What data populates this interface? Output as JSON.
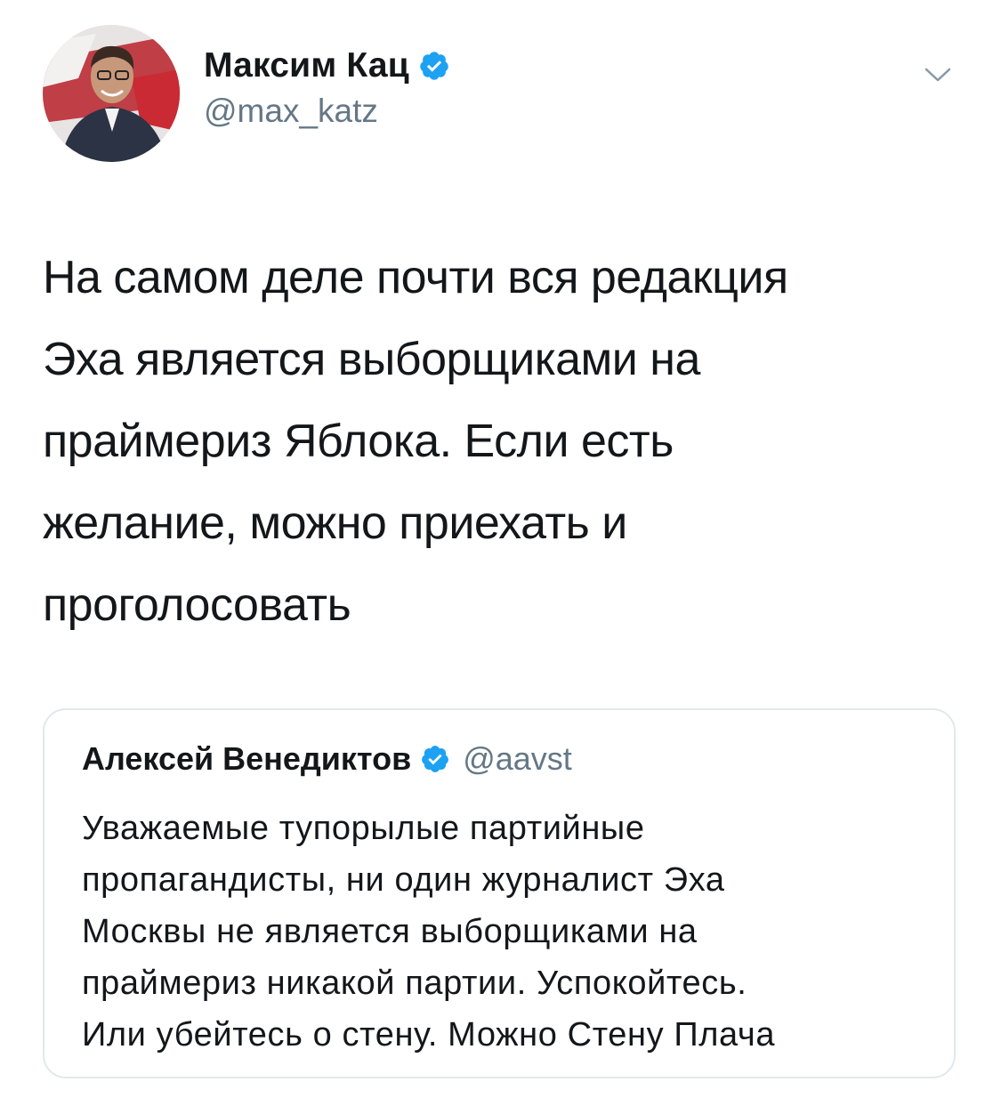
{
  "author": {
    "display_name": "Максим Кац",
    "handle": "@max_katz",
    "verified": true,
    "avatar_icon": "avatar-photo"
  },
  "menu_icon": "chevron-down-icon",
  "tweet": {
    "text": "На самом деле почти вся редакция\nЭха является выборщиками на\nпраймериз Яблока. Если есть\nжелание, можно приехать и\nпроголосовать"
  },
  "quoted_tweet": {
    "display_name": "Алексей Венедиктов",
    "handle": "@aavst",
    "verified": true,
    "text": "Уважаемые тупорылые партийные\nпропагандисты, ни один журналист Эха\nМосквы не является  выборщиками на\nпраймериз никакой партии. Успокойтесь.\nИли убейтесь о стену. Можно Стену Плача"
  },
  "colors": {
    "verified_blue": "#1da1f2",
    "text_primary": "#14171a",
    "text_secondary": "#657786",
    "border": "#e1e8ed"
  }
}
